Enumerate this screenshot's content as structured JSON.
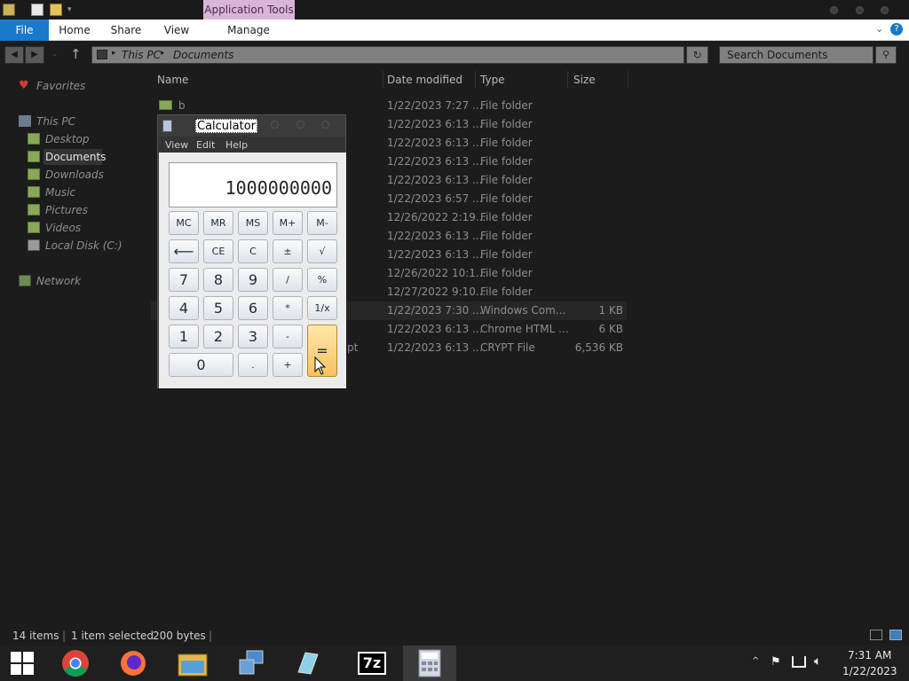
{
  "ribbon": {
    "context_label": "Application Tools",
    "tabs": [
      "File",
      "Home",
      "Share",
      "View",
      "Manage"
    ]
  },
  "address": {
    "crumbs": [
      "This PC",
      "Documents"
    ],
    "search_placeholder": "Search Documents"
  },
  "nav": {
    "favorites": "Favorites",
    "this_pc": "This PC",
    "items": [
      "Desktop",
      "Documents",
      "Downloads",
      "Music",
      "Pictures",
      "Videos",
      "Local Disk (C:)"
    ],
    "network": "Network"
  },
  "columns": [
    "Name",
    "Date modified",
    "Type",
    "Size"
  ],
  "files": [
    {
      "name": "b",
      "date": "1/22/2023 7:27 ...",
      "type": "File folder",
      "size": ""
    },
    {
      "name": "",
      "date": "1/22/2023 6:13 ...",
      "type": "File folder",
      "size": ""
    },
    {
      "name": "",
      "date": "1/22/2023 6:13 ...",
      "type": "File folder",
      "size": ""
    },
    {
      "name": "",
      "date": "1/22/2023 6:13 ...",
      "type": "File folder",
      "size": ""
    },
    {
      "name": "",
      "date": "1/22/2023 6:13 ...",
      "type": "File folder",
      "size": ""
    },
    {
      "name": "",
      "date": "1/22/2023 6:57 ...",
      "type": "File folder",
      "size": ""
    },
    {
      "name": "",
      "date": "12/26/2022 2:19...",
      "type": "File folder",
      "size": ""
    },
    {
      "name": "",
      "date": "1/22/2023 6:13 ...",
      "type": "File folder",
      "size": ""
    },
    {
      "name": "",
      "date": "1/22/2023 6:13 ...",
      "type": "File folder",
      "size": ""
    },
    {
      "name": "",
      "date": "12/26/2022 10:1...",
      "type": "File folder",
      "size": ""
    },
    {
      "name": "",
      "date": "12/27/2022 9:10...",
      "type": "File folder",
      "size": ""
    },
    {
      "name": "",
      "date": "1/22/2023 7:30 ...",
      "type": "Windows Com...",
      "size": "1 KB"
    },
    {
      "name": "",
      "date": "1/22/2023 6:13 ...",
      "type": "Chrome HTML ...",
      "size": "6 KB"
    },
    {
      "name": "pt",
      "date": "1/22/2023 6:13 ...",
      "type": "CRYPT File",
      "size": "6,536 KB"
    }
  ],
  "calculator": {
    "title": "Calculator",
    "menu": [
      "View",
      "Edit",
      "Help"
    ],
    "display": "1000000000",
    "memory_keys": [
      "MC",
      "MR",
      "MS",
      "M+",
      "M-"
    ],
    "row2": [
      "⟵",
      "CE",
      "C",
      "±",
      "√"
    ],
    "row3": [
      "7",
      "8",
      "9",
      "/",
      "%"
    ],
    "row4": [
      "4",
      "5",
      "6",
      "*",
      "1/x"
    ],
    "row5": [
      "1",
      "2",
      "3",
      "-"
    ],
    "zero": "0",
    "dot": ".",
    "plus": "+",
    "equals": "="
  },
  "status": {
    "items": "14 items",
    "selected": "1 item selected",
    "size": "200 bytes"
  },
  "taskbar": {
    "sevenzip_label": "7z",
    "time": "7:31 AM",
    "date": "1/22/2023"
  },
  "colors": {
    "file_tab": "#1979ca",
    "app_tools": "#d9b6d9",
    "equals_key": "#f6c260"
  }
}
